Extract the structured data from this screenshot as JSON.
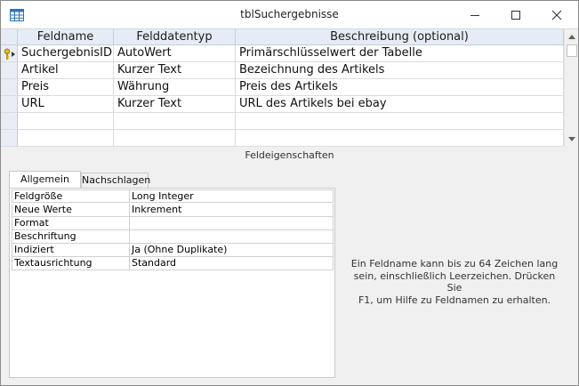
{
  "window": {
    "title": "tblSuchergebnisse",
    "icon": "table-icon"
  },
  "grid": {
    "columns": [
      "Feldname",
      "Felddatentyp",
      "Beschreibung (optional)"
    ],
    "rows": [
      {
        "name": "SuchergebnisID",
        "type": "AutoWert",
        "description": "Primärschlüsselwert der Tabelle",
        "primary_key": true
      },
      {
        "name": "Artikel",
        "type": "Kurzer Text",
        "description": "Bezeichnung des Artikels",
        "primary_key": false
      },
      {
        "name": "Preis",
        "type": "Währung",
        "description": "Preis des Artikels",
        "primary_key": false
      },
      {
        "name": "URL",
        "type": "Kurzer Text",
        "description": "URL des Artikels bei ebay",
        "primary_key": false
      },
      {
        "name": "",
        "type": "",
        "description": "",
        "primary_key": false
      },
      {
        "name": "",
        "type": "",
        "description": "",
        "primary_key": false
      }
    ]
  },
  "properties": {
    "section_label": "Feldeigenschaften",
    "tabs": [
      {
        "label": "Allgemein",
        "active": true
      },
      {
        "label": "Nachschlagen",
        "active": false
      }
    ],
    "rows": [
      {
        "name": "Feldgröße",
        "value": "Long Integer"
      },
      {
        "name": "Neue Werte",
        "value": "Inkrement"
      },
      {
        "name": "Format",
        "value": ""
      },
      {
        "name": "Beschriftung",
        "value": ""
      },
      {
        "name": "Indiziert",
        "value": "Ja (Ohne Duplikate)"
      },
      {
        "name": "Textausrichtung",
        "value": "Standard"
      }
    ]
  },
  "help": {
    "line1": "Ein Feldname kann bis zu 64 Zeichen lang",
    "line2": "sein, einschließlich Leerzeichen. Drücken Sie",
    "line3": "F1, um Hilfe zu Feldnamen zu erhalten."
  },
  "colors": {
    "header_bg": "#e6ecf5",
    "key_icon": "#e8b923"
  }
}
